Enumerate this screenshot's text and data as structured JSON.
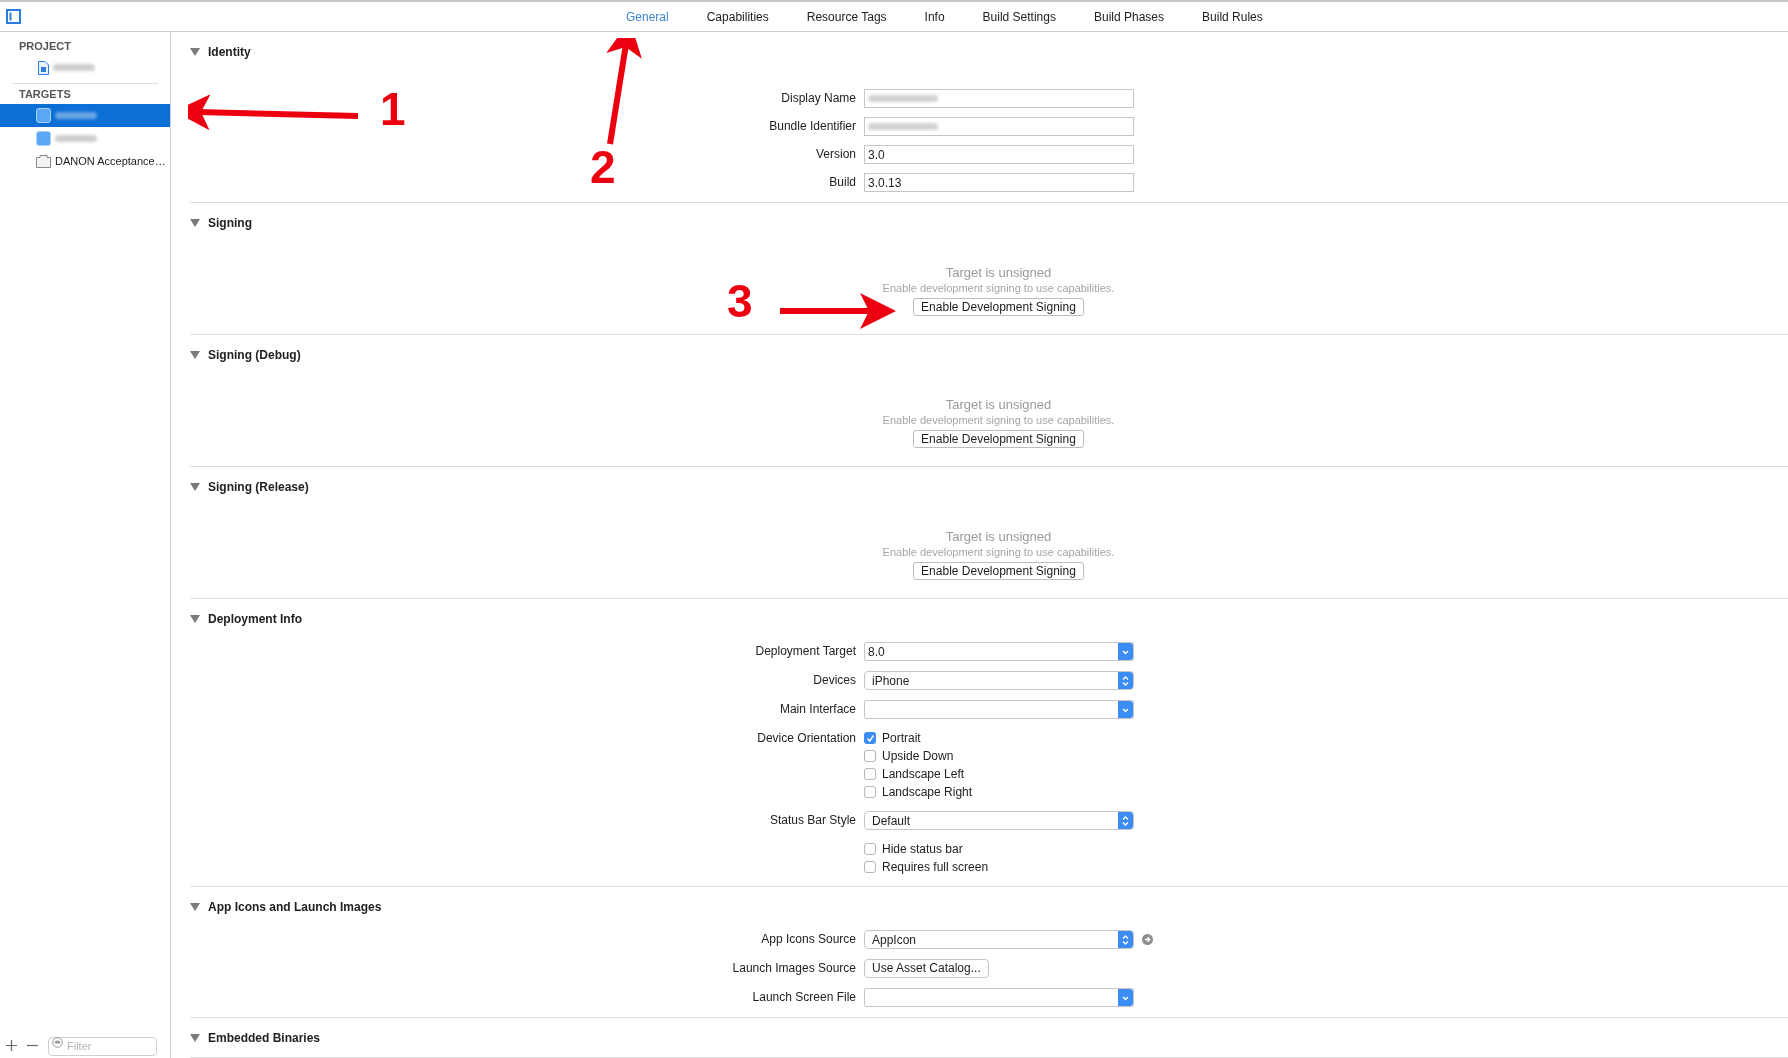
{
  "tabs": [
    {
      "label": "General",
      "selected": true
    },
    {
      "label": "Capabilities",
      "selected": false
    },
    {
      "label": "Resource Tags",
      "selected": false
    },
    {
      "label": "Info",
      "selected": false
    },
    {
      "label": "Build Settings",
      "selected": false
    },
    {
      "label": "Build Phases",
      "selected": false
    },
    {
      "label": "Build Rules",
      "selected": false
    }
  ],
  "sidebar": {
    "groups": [
      {
        "title": "PROJECT",
        "items": [
          {
            "kind": "project",
            "blurred": true,
            "selected": false
          }
        ]
      },
      {
        "title": "TARGETS",
        "items": [
          {
            "kind": "app",
            "blurred": true,
            "selected": true
          },
          {
            "kind": "app",
            "blurred": true,
            "selected": false
          },
          {
            "kind": "bundle",
            "label": "DANON Acceptance…",
            "selected": false
          }
        ]
      }
    ],
    "filter": {
      "placeholder": "Filter"
    }
  },
  "sections": [
    {
      "title": "Identity",
      "expanded": true,
      "rows": [
        {
          "kind": "text",
          "label": "Display Name",
          "blurred": true
        },
        {
          "kind": "text",
          "label": "Bundle Identifier",
          "blurred": true
        },
        {
          "kind": "text",
          "label": "Version",
          "value": "3.0"
        },
        {
          "kind": "text",
          "label": "Build",
          "value": "3.0.13"
        }
      ]
    },
    {
      "title": "Signing",
      "expanded": true,
      "rows": [
        {
          "kind": "notice",
          "title": "Target is unsigned",
          "message": "Enable development signing to use capabilities.",
          "button": "Enable Development Signing"
        }
      ]
    },
    {
      "title": "Signing (Debug)",
      "expanded": true,
      "rows": [
        {
          "kind": "notice",
          "title": "Target is unsigned",
          "message": "Enable development signing to use capabilities.",
          "button": "Enable Development Signing"
        }
      ]
    },
    {
      "title": "Signing (Release)",
      "expanded": true,
      "rows": [
        {
          "kind": "notice",
          "title": "Target is unsigned",
          "message": "Enable development signing to use capabilities.",
          "button": "Enable Development Signing"
        }
      ]
    },
    {
      "title": "Deployment Info",
      "expanded": true,
      "rows": [
        {
          "kind": "combo",
          "label": "Deployment Target",
          "value": "8.0"
        },
        {
          "kind": "popup",
          "label": "Devices",
          "value": "iPhone"
        },
        {
          "kind": "combo",
          "label": "Main Interface"
        },
        {
          "kind": "checkboxes",
          "label": "Device Orientation",
          "options": [
            {
              "label": "Portrait",
              "checked": true
            },
            {
              "label": "Upside Down",
              "checked": false
            },
            {
              "label": "Landscape Left",
              "checked": false
            },
            {
              "label": "Landscape Right",
              "checked": false
            }
          ]
        },
        {
          "kind": "popup",
          "label": "Status Bar Style",
          "value": "Default"
        },
        {
          "kind": "checkboxes",
          "options": [
            {
              "label": "Hide status bar",
              "checked": false
            },
            {
              "label": "Requires full screen",
              "checked": false
            }
          ]
        }
      ]
    },
    {
      "title": "App Icons and Launch Images",
      "expanded": true,
      "rows": [
        {
          "kind": "popup",
          "label": "App Icons Source",
          "value": "AppIcon",
          "go_arrow": true
        },
        {
          "kind": "button",
          "label": "Launch Images Source",
          "value": "Use Asset Catalog..."
        },
        {
          "kind": "combo",
          "label": "Launch Screen File"
        }
      ]
    },
    {
      "title": "Embedded Binaries",
      "expanded": true
    }
  ],
  "annotations": [
    {
      "label": "1"
    },
    {
      "label": "2"
    },
    {
      "label": "3"
    }
  ]
}
